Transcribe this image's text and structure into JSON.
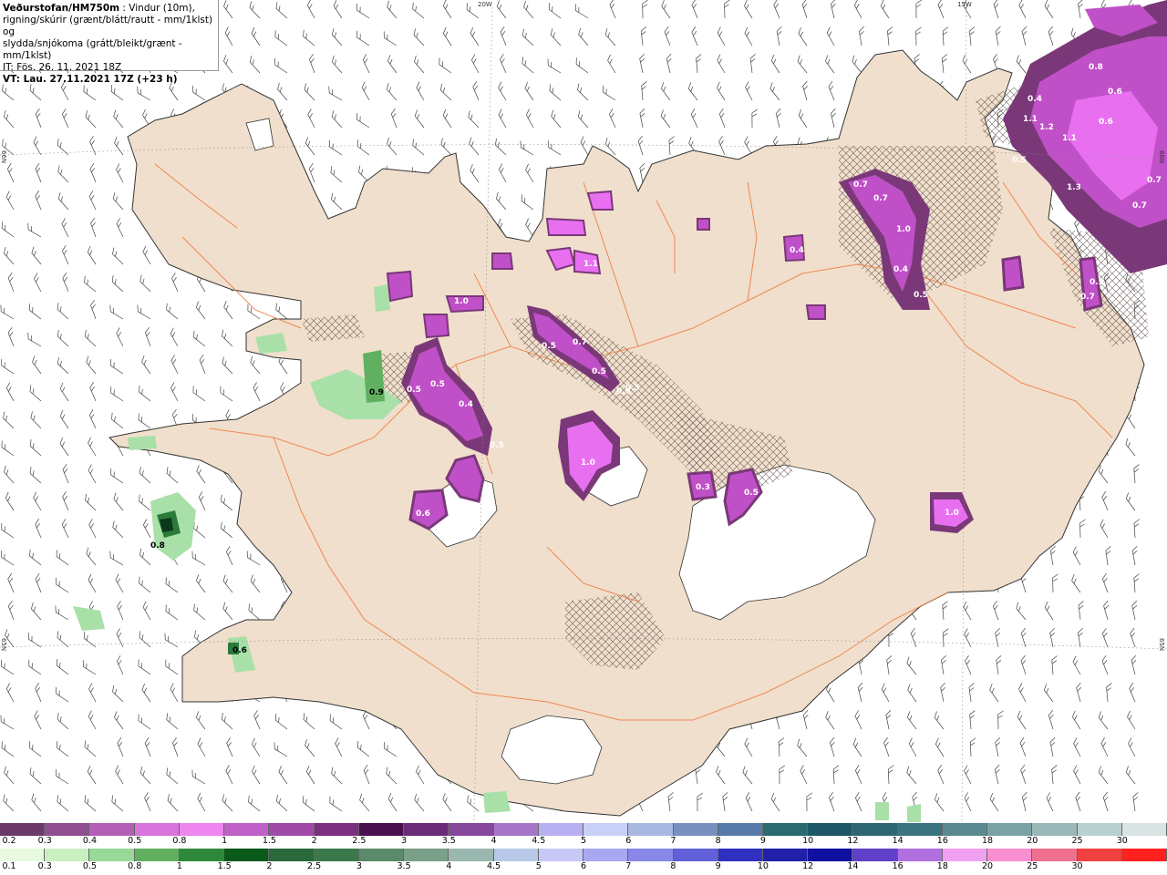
{
  "title": {
    "line1_bold": "Veðurstofan/HM750m",
    "line1_rest": " : Vindur (10m),",
    "line2": "rigning/skúrir (grænt/blátt/rautt - mm/1klst) og",
    "line3": "slydda/snjókoma (grátt/bleikt/grænt - mm/1klst)",
    "line4": "IT: Fös. 26. 11. 2021 18Z",
    "line5": "VT: Lau. 27.11.2021 17Z (+23 h)"
  },
  "coordinates": {
    "lon_20w": "20W",
    "lon_15w": "15W",
    "lat_66n_left": "66N",
    "lat_66n_right": "66N",
    "lat_65n_left": "65N",
    "lat_65n_right": "65N"
  },
  "colors": {
    "land": "#f0dfcc",
    "sea": "#ffffff",
    "roads": "#f07840",
    "snow_purple": "#c050c8",
    "snow_pink": "#e870f0",
    "snow_dark": "#7a3878",
    "rain_green": "#a8e0a8",
    "rain_dark_green": "#2a7a3a"
  },
  "precip_labels": [
    {
      "text": "0.8"
    },
    {
      "text": "0.6"
    },
    {
      "text": "0.4"
    },
    {
      "text": "1.1"
    },
    {
      "text": "1.2"
    },
    {
      "text": "1.1"
    },
    {
      "text": "0.6"
    },
    {
      "text": "0.5"
    },
    {
      "text": "1.3"
    },
    {
      "text": "0.7"
    },
    {
      "text": "0.7"
    },
    {
      "text": "0.7"
    },
    {
      "text": "0.7"
    },
    {
      "text": "1.0"
    },
    {
      "text": "0.4"
    },
    {
      "text": "0.4"
    },
    {
      "text": "0.5"
    },
    {
      "text": "0.7"
    },
    {
      "text": "0.5"
    },
    {
      "text": "0.5"
    },
    {
      "text": "0.4"
    },
    {
      "text": "0.5"
    },
    {
      "text": "0.5"
    },
    {
      "text": "1.0"
    },
    {
      "text": "0.5"
    },
    {
      "text": "0.5"
    },
    {
      "text": "0.6"
    },
    {
      "text": "1.0"
    },
    {
      "text": "0.3"
    },
    {
      "text": "0.5"
    },
    {
      "text": "1.1"
    },
    {
      "text": "0.6"
    },
    {
      "text": "0.9"
    },
    {
      "text": "0.8"
    },
    {
      "text": "0.6"
    },
    {
      "text": "1.0"
    },
    {
      "text": "0.7"
    },
    {
      "text": "0.5"
    }
  ],
  "legend_snow": {
    "labels": [
      "0.2",
      "0.3",
      "0.4",
      "0.5",
      "0.8",
      "1",
      "1.5",
      "2",
      "2.5",
      "3",
      "3.5",
      "4",
      "4.5",
      "5",
      "6",
      "7",
      "8",
      "9",
      "10",
      "12",
      "14",
      "16",
      "18",
      "20",
      "25",
      "30"
    ],
    "colors": [
      "#6b3a6b",
      "#8e4e90",
      "#b35fb8",
      "#d874dc",
      "#ee86f0",
      "#c060c8",
      "#a04aa8",
      "#7a2f80",
      "#4a0f4e",
      "#6a2c78",
      "#86489a",
      "#a676c8",
      "#b8b0f0",
      "#c8d0f8",
      "#a8b8e0",
      "#7890c0",
      "#587aa8",
      "#2a6a70",
      "#1e5866",
      "#2e6674",
      "#3a7480",
      "#5a8a90",
      "#7aa2a4",
      "#9ab8b8",
      "#b8d0d0",
      "#d8e4e4"
    ]
  },
  "legend_rain": {
    "labels": [
      "0.1",
      "0.3",
      "0.5",
      "0.8",
      "1",
      "1.5",
      "2",
      "2.5",
      "3",
      "3.5",
      "4",
      "4.5",
      "5",
      "6",
      "7",
      "8",
      "9",
      "10",
      "12",
      "14",
      "16",
      "18",
      "20",
      "25",
      "30"
    ],
    "colors": [
      "#e8fae0",
      "#c8f0c0",
      "#98d898",
      "#60b060",
      "#2e8a3a",
      "#0a5a1a",
      "#2a6a3a",
      "#3a7a4a",
      "#5a8a6a",
      "#7aa08a",
      "#9ab8b0",
      "#b8c8e8",
      "#c8c8f8",
      "#a8a8f0",
      "#8888e8",
      "#6060d8",
      "#3030c0",
      "#2020a8",
      "#1010a0",
      "#6040c8",
      "#b070e0",
      "#f0a0f0",
      "#f890d0",
      "#f07090",
      "#f04040",
      "#ff2020"
    ]
  }
}
